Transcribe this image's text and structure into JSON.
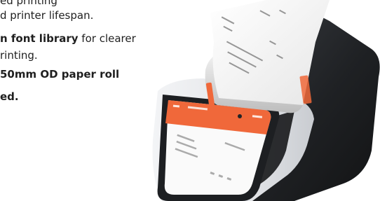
{
  "copy": {
    "line1": "ed printing",
    "line2": "d printer lifespan.",
    "line3_bold": "n font library",
    "line3_rest": " for clearer",
    "line4": "rinting.",
    "line5": "50mm OD paper roll",
    "line6": "ed."
  },
  "colors": {
    "accent": "#f0683a",
    "text": "#1f1f1f",
    "device_dark": "#26282b",
    "device_light": "#e9ebee",
    "screen": "#fafafa"
  }
}
